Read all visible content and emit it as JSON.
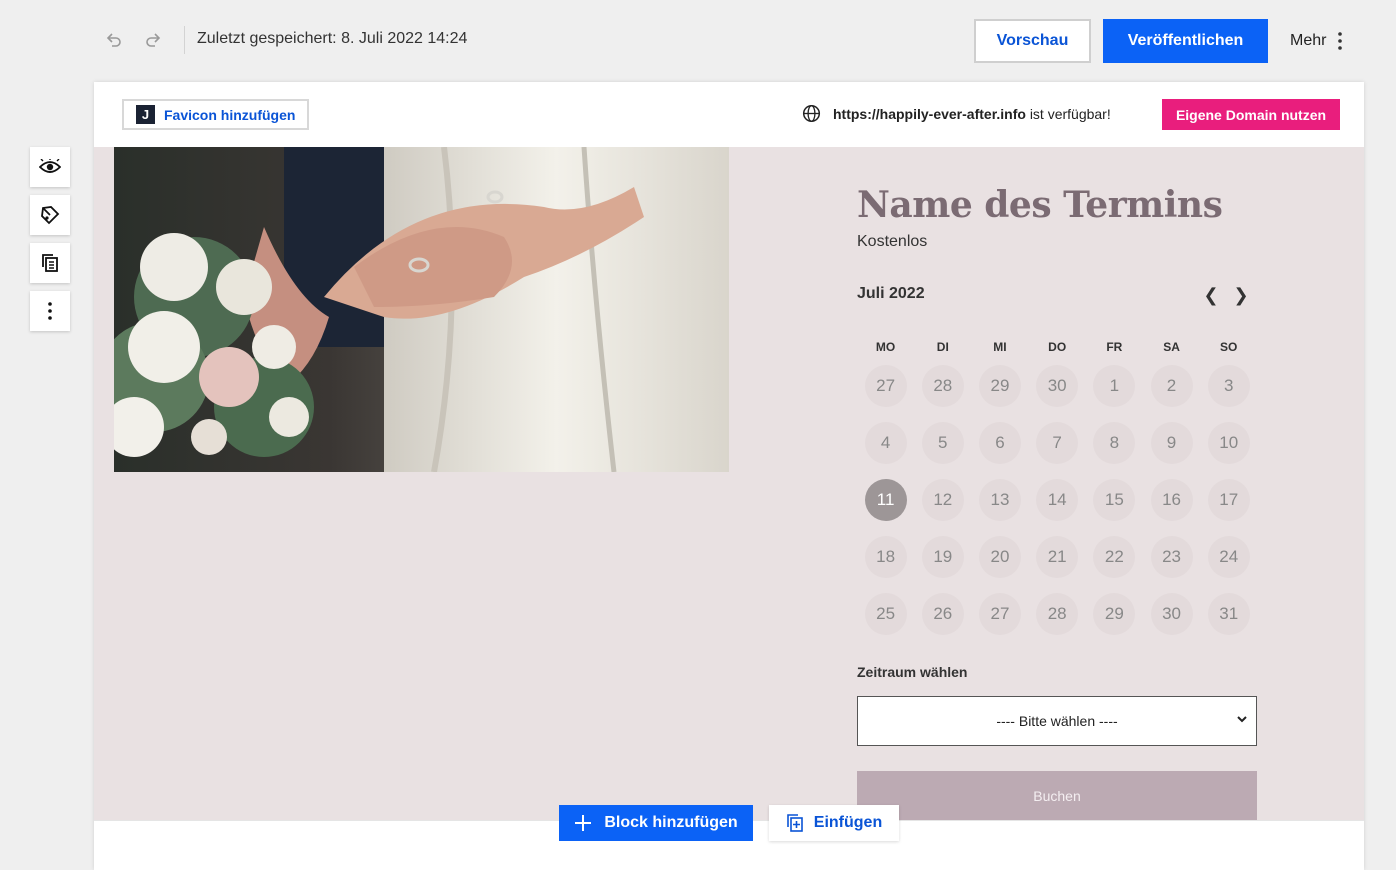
{
  "toolbar": {
    "undo_icon": "undo-icon",
    "redo_icon": "redo-icon",
    "saved_text": "Zuletzt gespeichert: 8. Juli 2022 14:24",
    "preview_label": "Vorschau",
    "publish_label": "Veröffentlichen",
    "more_label": "Mehr"
  },
  "header": {
    "favicon_letter": "J",
    "favicon_label": "Favicon hinzufügen",
    "domain_url": "https://happily-ever-after.info",
    "domain_status": "ist verfügbar!",
    "domain_button": "Eigene Domain nutzen"
  },
  "booking": {
    "title": "Name des Termins",
    "price": "Kostenlos",
    "month": "Juli 2022",
    "prev": "❮",
    "next": "❯",
    "weekdays": [
      "MO",
      "DI",
      "MI",
      "DO",
      "FR",
      "SA",
      "SO"
    ],
    "days": [
      "27",
      "28",
      "29",
      "30",
      "1",
      "2",
      "3",
      "4",
      "5",
      "6",
      "7",
      "8",
      "9",
      "10",
      "11",
      "12",
      "13",
      "14",
      "15",
      "16",
      "17",
      "18",
      "19",
      "20",
      "21",
      "22",
      "23",
      "24",
      "25",
      "26",
      "27",
      "28",
      "29",
      "30",
      "31"
    ],
    "selected_day": "11",
    "slot_label": "Zeitraum wählen",
    "slot_placeholder": "---- Bitte wählen ----",
    "book_label": "Buchen"
  },
  "rail": [
    "eye-icon",
    "paint-icon",
    "copy-icon",
    "more-vertical-icon"
  ],
  "bottom": {
    "add_block_label": "Block hinzufügen",
    "paste_label": "Einfügen"
  },
  "colors": {
    "accent_blue": "#0b62f6",
    "domain_pink": "#e91e7d",
    "section_bg": "#e9e1e2",
    "title_color": "#7b6b73",
    "book_button": "#bcaab3"
  }
}
